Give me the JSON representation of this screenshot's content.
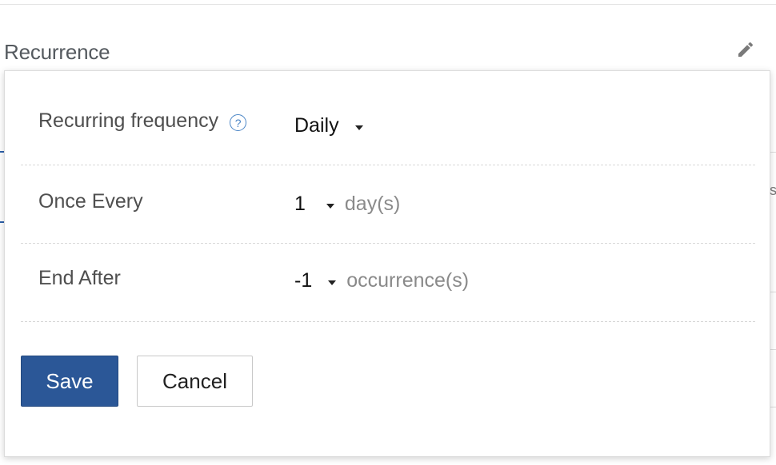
{
  "section": {
    "title": "Recurrence",
    "edit_icon": "pencil-icon"
  },
  "popup": {
    "rows": [
      {
        "label": "Recurring frequency",
        "help_icon": "question-circle-icon",
        "value": "Daily",
        "unit": ""
      },
      {
        "label": "Once Every",
        "value": "1",
        "unit": "day(s)"
      },
      {
        "label": "End After",
        "value": "-1",
        "unit": "occurrence(s)"
      }
    ],
    "actions": {
      "save_label": "Save",
      "cancel_label": "Cancel"
    }
  },
  "colors": {
    "primary": "#2b5797",
    "help_icon": "#4c86c6",
    "label_text": "#4f4f4f",
    "unit_text": "#8a8a8a"
  }
}
